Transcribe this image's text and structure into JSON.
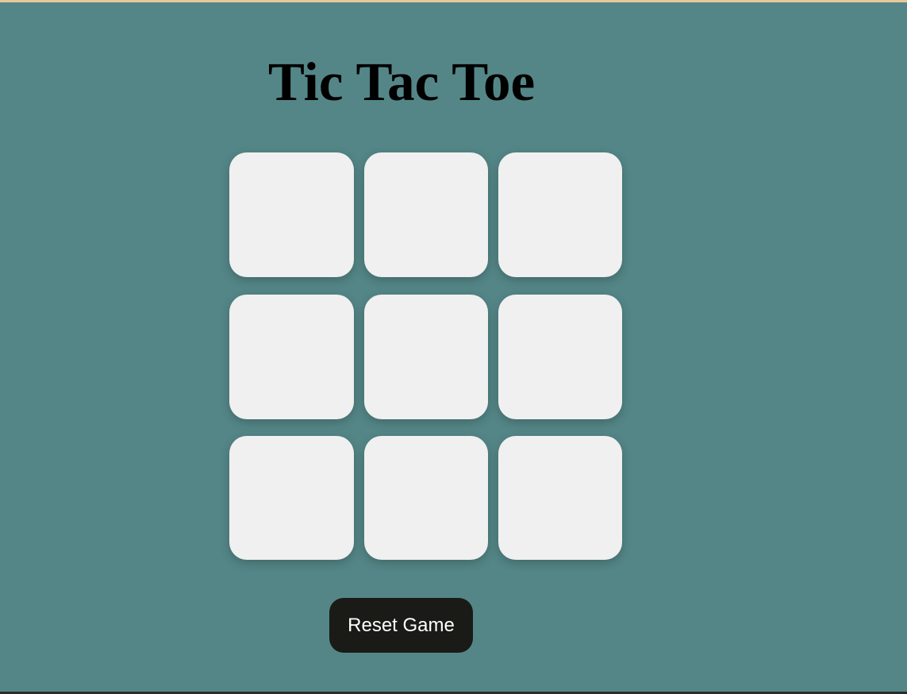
{
  "title": "Tic Tac Toe",
  "board": {
    "cells": [
      "",
      "",
      "",
      "",
      "",
      "",
      "",
      "",
      ""
    ]
  },
  "reset_button_label": "Reset Game",
  "colors": {
    "background": "#548687",
    "cell": "#f0f0f0",
    "button": "#1a1a17",
    "button_text": "#ffffff",
    "title_text": "#000000"
  }
}
